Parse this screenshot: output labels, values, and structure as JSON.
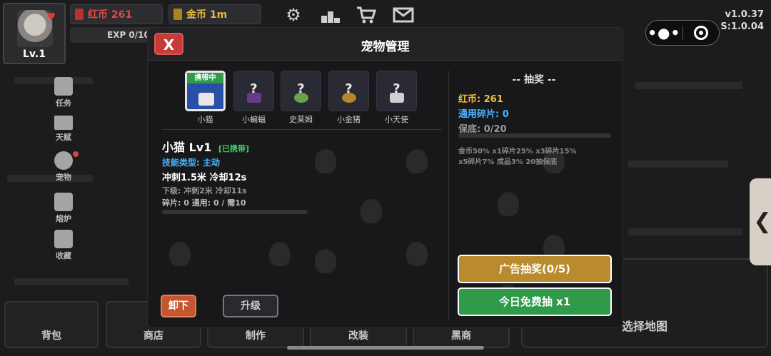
{
  "hud": {
    "level": "Lv.1",
    "exp_label": "EXP 0/10",
    "red_coin": "红币 261",
    "gold_coin": "金币 1m",
    "version": "v1.0.37",
    "server_version": "S:1.0.04",
    "icons": [
      "gear-icon",
      "ranking-icon",
      "cart-icon",
      "mail-icon"
    ]
  },
  "sidebar": {
    "items": [
      {
        "label": "任务",
        "icon": "clipboard-icon"
      },
      {
        "label": "天赋",
        "icon": "dumbbell-icon"
      },
      {
        "label": "宠物",
        "icon": "paw-icon"
      },
      {
        "label": "熔炉",
        "icon": "hammer-icon"
      },
      {
        "label": "收藏",
        "icon": "chest-icon"
      }
    ]
  },
  "bottom_nav": {
    "items": [
      {
        "label": "背包"
      },
      {
        "label": "商店"
      },
      {
        "label": "制作"
      },
      {
        "label": "改装"
      },
      {
        "label": "黑商"
      }
    ],
    "select_map": "选择地图"
  },
  "modal": {
    "title": "宠物管理",
    "close": "X",
    "pets": [
      {
        "name": "小猫",
        "tag": "携带中",
        "locked": false,
        "color": "#e8e8e8"
      },
      {
        "name": "小蝙蝠",
        "locked": true,
        "color": "#6a3a8a"
      },
      {
        "name": "史莱姆",
        "locked": true,
        "color": "#6aa24a"
      },
      {
        "name": "小金猪",
        "locked": true,
        "color": "#b8862a"
      },
      {
        "name": "小天使",
        "locked": true,
        "color": "#cfcfcf"
      }
    ],
    "pets_q": "?",
    "detail": {
      "name": "小猫",
      "level": "Lv1",
      "carried": "[已携带]",
      "skill_type": "技能类型: 主动",
      "effect": "冲刺1.5米 冷却12s",
      "next_level": "下级: 冲刺2米 冷却11s",
      "fragments": "碎片: 0 通用: 0 / 需10",
      "progress": 0
    },
    "buttons": {
      "unequip": "卸下",
      "upgrade": "升级"
    },
    "lottery": {
      "title": "-- 抽奖 --",
      "red_coin": "红币: 261",
      "shared_fragments": "通用碎片: 0",
      "pity": "保底: 0/20",
      "pity_progress": 0,
      "rates_line1": "金币50% x1碎片25% x3碎片15%",
      "rates_line2": "x5碎片7% 成品3% 20抽保底",
      "ad_draw": "广告抽奖(0/5)",
      "free_draw": "今日免费抽 x1"
    }
  },
  "colors": {
    "red_button": "#c73b3b",
    "green_tag": "#2e9a4a",
    "gold_text": "#f0c040",
    "blue_text": "#48b4ff",
    "ad_button": "#b98a2e",
    "free_button": "#2e9a4a",
    "unequip_button": "#c7552f"
  }
}
